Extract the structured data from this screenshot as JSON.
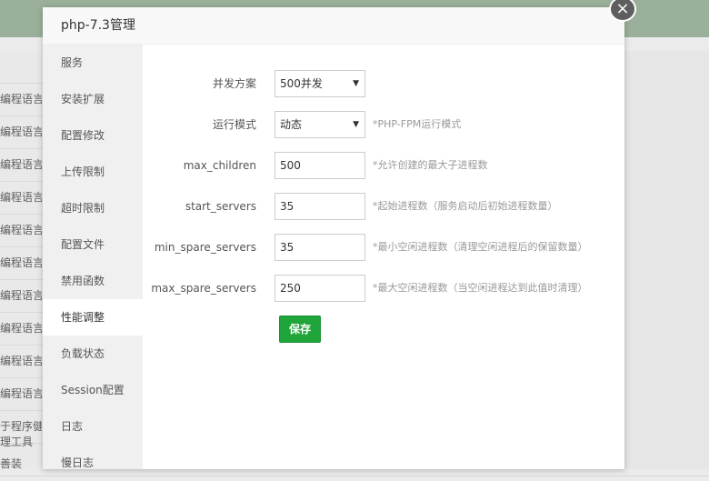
{
  "background": {
    "row_texts": [
      "编程语言",
      "编程语言",
      "编程语言",
      "编程语言",
      "编程语言",
      "编程语言",
      "编程语言",
      "编程语言",
      "编程语言",
      "编程语言",
      "于程序健",
      "理工具",
      "善装"
    ]
  },
  "dialog": {
    "title": "php-7.3管理",
    "close_symbol": "×",
    "sidebar": [
      {
        "label": "服务",
        "active": false
      },
      {
        "label": "安装扩展",
        "active": false
      },
      {
        "label": "配置修改",
        "active": false
      },
      {
        "label": "上传限制",
        "active": false
      },
      {
        "label": "超时限制",
        "active": false
      },
      {
        "label": "配置文件",
        "active": false
      },
      {
        "label": "禁用函数",
        "active": false
      },
      {
        "label": "性能调整",
        "active": true
      },
      {
        "label": "负载状态",
        "active": false
      },
      {
        "label": "Session配置",
        "active": false
      },
      {
        "label": "日志",
        "active": false
      },
      {
        "label": "慢日志",
        "active": false
      }
    ],
    "form": {
      "concurrency": {
        "label": "并发方案",
        "value": "500并发",
        "caret": "▼",
        "hint": ""
      },
      "run_mode": {
        "label": "运行模式",
        "value": "动态",
        "caret": "▼",
        "hint": "*PHP-FPM运行模式"
      },
      "max_children": {
        "label": "max_children",
        "value": "500",
        "hint": "*允许创建的最大子进程数"
      },
      "start_servers": {
        "label": "start_servers",
        "value": "35",
        "hint": "*起始进程数（服务启动后初始进程数量）"
      },
      "min_spare_servers": {
        "label": "min_spare_servers",
        "value": "35",
        "hint": "*最小空闲进程数（清理空闲进程后的保留数量）"
      },
      "max_spare_servers": {
        "label": "max_spare_servers",
        "value": "250",
        "hint": "*最大空闲进程数（当空闲进程达到此值时清理）"
      },
      "save_label": "保存"
    }
  },
  "colors": {
    "accent": "#20a53a",
    "header_bg": "#9ab09a"
  }
}
